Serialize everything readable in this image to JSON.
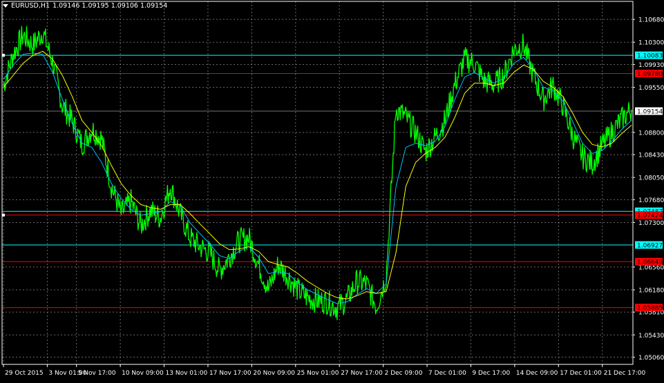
{
  "header": {
    "symbol": "EURUSD,H1",
    "ohlc": "1.09146 1.09195 1.09106 1.09154"
  },
  "colors": {
    "background": "#000000",
    "grid": "#c0c0c0",
    "price": "#00ff00",
    "ma_fast": "#00bfff",
    "ma_slow": "#ffff00",
    "resistance_line": "#00ffff",
    "support_line": "#ff0000",
    "current_price_label": "#ffffff",
    "axis_text": "#ffffff"
  },
  "chart_data": {
    "type": "line",
    "title": "EURUSD,H1",
    "xlabel": "",
    "ylabel": "",
    "ylim": [
      1.0494,
      1.1098
    ],
    "grid": true,
    "y_ticks": [
      "1.10680",
      "1.10300",
      "1.09930",
      "1.09550",
      "1.08800",
      "1.08430",
      "1.08050",
      "1.07680",
      "1.07300",
      "1.06560",
      "1.06180",
      "1.05810",
      "1.05430",
      "1.05060"
    ],
    "x_ticks": [
      "29 Oct 2015",
      "3 Nov 01:00",
      "5 Nov 17:00",
      "10 Nov 09:00",
      "13 Nov 01:00",
      "17 Nov 17:00",
      "20 Nov 09:00",
      "25 Nov 01:00",
      "27 Nov 17:00",
      "2 Dec 09:00",
      "7 Dec 01:00",
      "9 Dec 17:00",
      "14 Dec 09:00",
      "17 Dec 01:00",
      "21 Dec 17:00"
    ],
    "x_tick_index": [
      0,
      3,
      5,
      8,
      11,
      14,
      17,
      20,
      23,
      26,
      29,
      32,
      35,
      38,
      41
    ],
    "x_count": 44,
    "series": [
      {
        "role": "price",
        "values": [
          1.0958,
          1.101,
          1.1042,
          1.1025,
          1.1047,
          1.0998,
          1.0925,
          1.09,
          1.086,
          1.0885,
          1.087,
          1.079,
          1.0745,
          1.0765,
          1.0725,
          1.075,
          1.0738,
          1.079,
          1.0745,
          1.0705,
          1.069,
          1.068,
          1.065,
          1.0672,
          1.07,
          1.0705,
          1.066,
          1.0618,
          1.066,
          1.064,
          1.0618,
          1.0605,
          1.06,
          1.0598,
          1.0588,
          1.0602,
          1.0632,
          1.0628,
          1.059,
          1.064,
          1.092,
          1.0905,
          1.088,
          1.0848,
          1.0872,
          1.09,
          1.096,
          1.1002,
          1.0995,
          1.0965,
          1.096,
          1.0975,
          1.1018,
          1.1025,
          1.0975,
          1.0935,
          1.0958,
          1.0925,
          1.0875,
          1.084,
          1.0828,
          1.0858,
          1.088,
          1.0902,
          1.0918
        ]
      },
      {
        "role": "ma_fast",
        "values": [
          1.0968,
          1.0992,
          1.101,
          1.1012,
          1.101,
          1.098,
          1.0935,
          1.0895,
          1.0862,
          1.0855,
          1.083,
          1.0795,
          1.077,
          1.0752,
          1.0742,
          1.0745,
          1.0748,
          1.0765,
          1.0758,
          1.073,
          1.0712,
          1.0695,
          1.0675,
          1.067,
          1.0682,
          1.069,
          1.0672,
          1.0645,
          1.0648,
          1.0645,
          1.063,
          1.0618,
          1.061,
          1.0602,
          1.0595,
          1.0598,
          1.061,
          1.062,
          1.0612,
          1.0628,
          1.079,
          1.0855,
          1.0862,
          1.0858,
          1.0865,
          1.089,
          1.0935,
          1.0972,
          1.098,
          1.097,
          1.0962,
          1.097,
          1.0995,
          1.1005,
          1.0985,
          1.0955,
          1.095,
          1.0932,
          1.0898,
          1.0862,
          1.0845,
          1.085,
          1.0865,
          1.0885,
          1.09
        ]
      },
      {
        "role": "ma_slow",
        "values": [
          1.0955,
          1.0975,
          1.0995,
          1.1008,
          1.1015,
          1.1002,
          1.0975,
          1.094,
          1.09,
          1.088,
          1.0858,
          1.0825,
          1.0795,
          1.0775,
          1.076,
          1.0755,
          1.0752,
          1.076,
          1.076,
          1.0745,
          1.0728,
          1.0712,
          1.0695,
          1.0685,
          1.0686,
          1.069,
          1.0682,
          1.0665,
          1.066,
          1.0656,
          1.0645,
          1.0632,
          1.0622,
          1.0612,
          1.0605,
          1.0603,
          1.0608,
          1.0615,
          1.0612,
          1.0615,
          1.068,
          1.079,
          1.083,
          1.0845,
          1.0855,
          1.0872,
          1.0905,
          1.0945,
          1.0962,
          1.0962,
          1.0958,
          1.0962,
          1.098,
          1.0992,
          1.0985,
          1.0965,
          1.0955,
          1.094,
          1.0912,
          1.088,
          1.086,
          1.0856,
          1.0862,
          1.0878,
          1.0892
        ]
      }
    ],
    "horizontal_lines": [
      {
        "label": "1.10083",
        "value": 1.10083,
        "kind": "resistance"
      },
      {
        "label": "1.09780",
        "value": 1.0978,
        "kind": "support"
      },
      {
        "label": "1.09154",
        "value": 1.09154,
        "kind": "current"
      },
      {
        "label": "1.07487",
        "value": 1.07487,
        "kind": "resistance"
      },
      {
        "label": "1.07424",
        "value": 1.07424,
        "kind": "support"
      },
      {
        "label": "1.06927",
        "value": 1.06927,
        "kind": "resistance"
      },
      {
        "label": "1.06649",
        "value": 1.06649,
        "kind": "support"
      },
      {
        "label": "1.05885",
        "value": 1.05885,
        "kind": "support"
      }
    ]
  }
}
